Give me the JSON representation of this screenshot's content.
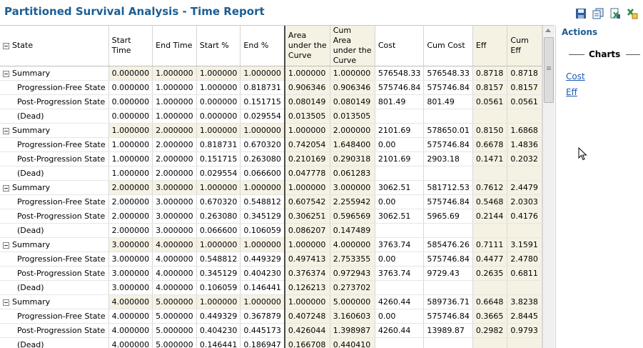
{
  "window": {
    "title": "Partitioned Survival Analysis - Time Report"
  },
  "toolbar": {
    "icons": [
      "save-icon",
      "copy-icon",
      "export-excel-icon",
      "export-excel-alt-icon"
    ]
  },
  "table": {
    "columns": [
      "State",
      "Start Time",
      "End Time",
      "Start %",
      "End %",
      "Area under the Curve",
      "Cum Area under the Curve",
      "Cost",
      "Cum Cost",
      "Eff",
      "Cum Eff"
    ],
    "rows": [
      {
        "type": "summary",
        "cells": [
          "Summary",
          "0.000000",
          "1.000000",
          "1.000000",
          "1.000000",
          "1.000000",
          "1.000000",
          "576548.33",
          "576548.33",
          "0.8718",
          "0.8718"
        ]
      },
      {
        "type": "child",
        "cells": [
          "Progression-Free State",
          "0.000000",
          "1.000000",
          "1.000000",
          "0.818731",
          "0.906346",
          "0.906346",
          "575746.84",
          "575746.84",
          "0.8157",
          "0.8157"
        ]
      },
      {
        "type": "child",
        "cells": [
          "Post-Progression State",
          "0.000000",
          "1.000000",
          "0.000000",
          "0.151715",
          "0.080149",
          "0.080149",
          "801.49",
          "801.49",
          "0.0561",
          "0.0561"
        ]
      },
      {
        "type": "child",
        "cells": [
          "(Dead)",
          "0.000000",
          "1.000000",
          "0.000000",
          "0.029554",
          "0.013505",
          "0.013505",
          "",
          "",
          "",
          ""
        ]
      },
      {
        "type": "summary",
        "cells": [
          "Summary",
          "1.000000",
          "2.000000",
          "1.000000",
          "1.000000",
          "1.000000",
          "2.000000",
          "2101.69",
          "578650.01",
          "0.8150",
          "1.6868"
        ]
      },
      {
        "type": "child",
        "cells": [
          "Progression-Free State",
          "1.000000",
          "2.000000",
          "0.818731",
          "0.670320",
          "0.742054",
          "1.648400",
          "0.00",
          "575746.84",
          "0.6678",
          "1.4836"
        ]
      },
      {
        "type": "child",
        "cells": [
          "Post-Progression State",
          "1.000000",
          "2.000000",
          "0.151715",
          "0.263080",
          "0.210169",
          "0.290318",
          "2101.69",
          "2903.18",
          "0.1471",
          "0.2032"
        ]
      },
      {
        "type": "child",
        "cells": [
          "(Dead)",
          "1.000000",
          "2.000000",
          "0.029554",
          "0.066600",
          "0.047778",
          "0.061283",
          "",
          "",
          "",
          ""
        ]
      },
      {
        "type": "summary",
        "cells": [
          "Summary",
          "2.000000",
          "3.000000",
          "1.000000",
          "1.000000",
          "1.000000",
          "3.000000",
          "3062.51",
          "581712.53",
          "0.7612",
          "2.4479"
        ]
      },
      {
        "type": "child",
        "cells": [
          "Progression-Free State",
          "2.000000",
          "3.000000",
          "0.670320",
          "0.548812",
          "0.607542",
          "2.255942",
          "0.00",
          "575746.84",
          "0.5468",
          "2.0303"
        ]
      },
      {
        "type": "child",
        "cells": [
          "Post-Progression State",
          "2.000000",
          "3.000000",
          "0.263080",
          "0.345129",
          "0.306251",
          "0.596569",
          "3062.51",
          "5965.69",
          "0.2144",
          "0.4176"
        ]
      },
      {
        "type": "child",
        "cells": [
          "(Dead)",
          "2.000000",
          "3.000000",
          "0.066600",
          "0.106059",
          "0.086207",
          "0.147489",
          "",
          "",
          "",
          ""
        ]
      },
      {
        "type": "summary",
        "cells": [
          "Summary",
          "3.000000",
          "4.000000",
          "1.000000",
          "1.000000",
          "1.000000",
          "4.000000",
          "3763.74",
          "585476.26",
          "0.7111",
          "3.1591"
        ]
      },
      {
        "type": "child",
        "cells": [
          "Progression-Free State",
          "3.000000",
          "4.000000",
          "0.548812",
          "0.449329",
          "0.497413",
          "2.753355",
          "0.00",
          "575746.84",
          "0.4477",
          "2.4780"
        ]
      },
      {
        "type": "child",
        "cells": [
          "Post-Progression State",
          "3.000000",
          "4.000000",
          "0.345129",
          "0.404230",
          "0.376374",
          "0.972943",
          "3763.74",
          "9729.43",
          "0.2635",
          "0.6811"
        ]
      },
      {
        "type": "child",
        "cells": [
          "(Dead)",
          "3.000000",
          "4.000000",
          "0.106059",
          "0.146441",
          "0.126213",
          "0.273702",
          "",
          "",
          "",
          ""
        ]
      },
      {
        "type": "summary",
        "cells": [
          "Summary",
          "4.000000",
          "5.000000",
          "1.000000",
          "1.000000",
          "1.000000",
          "5.000000",
          "4260.44",
          "589736.71",
          "0.6648",
          "3.8238"
        ]
      },
      {
        "type": "child",
        "cells": [
          "Progression-Free State",
          "4.000000",
          "5.000000",
          "0.449329",
          "0.367879",
          "0.407248",
          "3.160603",
          "0.00",
          "575746.84",
          "0.3665",
          "2.8445"
        ]
      },
      {
        "type": "child",
        "cells": [
          "Post-Progression State",
          "4.000000",
          "5.000000",
          "0.404230",
          "0.445173",
          "0.426044",
          "1.398987",
          "4260.44",
          "13989.87",
          "0.2982",
          "0.9793"
        ]
      },
      {
        "type": "child",
        "cells": [
          "(Dead)",
          "4.000000",
          "5.000000",
          "0.146441",
          "0.186947",
          "0.166708",
          "0.440410",
          "",
          "",
          "",
          ""
        ]
      }
    ]
  },
  "actions": {
    "title": "Actions",
    "section": "Charts",
    "links": [
      "Cost",
      "Eff"
    ]
  }
}
